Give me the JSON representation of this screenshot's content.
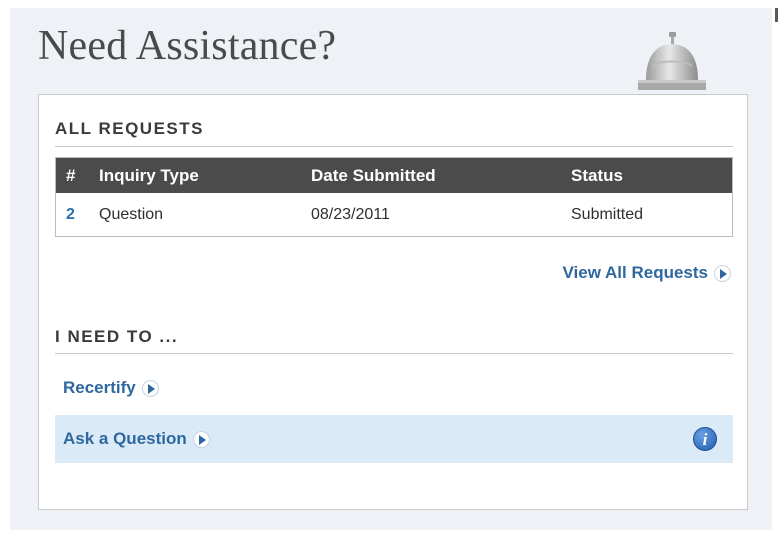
{
  "title": "Need Assistance?",
  "requests": {
    "heading": "ALL REQUESTS",
    "columns": [
      "#",
      "Inquiry Type",
      "Date Submitted",
      "Status"
    ],
    "rows": [
      {
        "num": "2",
        "type": "Question",
        "date": "08/23/2011",
        "status": "Submitted"
      }
    ],
    "view_all_label": "View All Requests"
  },
  "ineed": {
    "heading": "I NEED TO ...",
    "recertify_label": "Recertify",
    "ask_label": "Ask a Question",
    "info_glyph": "i"
  },
  "icons": {
    "bell": "service-bell-icon",
    "arrow": "circle-arrow-right-icon",
    "info": "info-icon"
  },
  "colors": {
    "link": "#2f679f",
    "header_bg": "#4b4b4b",
    "highlight_row": "#dbeaf7",
    "panel_bg": "#eef2f7"
  }
}
